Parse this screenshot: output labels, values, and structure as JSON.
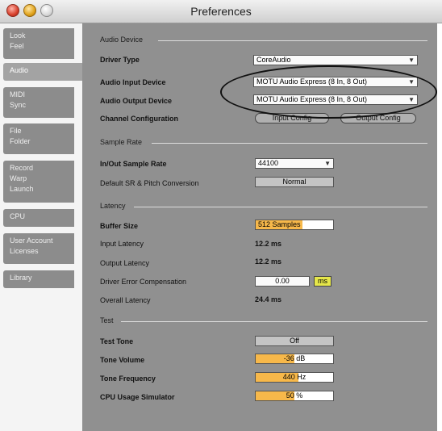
{
  "window": {
    "title": "Preferences"
  },
  "sidebar": {
    "tabs": [
      {
        "line1": "Look",
        "line2": "Feel",
        "line3": ""
      },
      {
        "line1": "Audio",
        "line2": "",
        "line3": ""
      },
      {
        "line1": "MIDI",
        "line2": "Sync",
        "line3": ""
      },
      {
        "line1": "File",
        "line2": "Folder",
        "line3": ""
      },
      {
        "line1": "Record",
        "line2": "Warp",
        "line3": "Launch"
      },
      {
        "line1": "CPU",
        "line2": "",
        "line3": ""
      },
      {
        "line1": "User Account",
        "line2": "Licenses",
        "line3": ""
      },
      {
        "line1": "Library",
        "line2": "",
        "line3": ""
      }
    ],
    "active": "Audio"
  },
  "audio_device": {
    "section": "Audio Device",
    "driver_type": {
      "label": "Driver Type",
      "value": "CoreAudio"
    },
    "input_device": {
      "label": "Audio Input Device",
      "value": "MOTU Audio Express (8 In, 8 Out)"
    },
    "output_device": {
      "label": "Audio Output Device",
      "value": "MOTU Audio Express (8 In, 8 Out)"
    },
    "channel_config": {
      "label": "Channel Configuration",
      "input_button": "Input Config",
      "output_button": "Output Config"
    }
  },
  "sample_rate": {
    "section": "Sample Rate",
    "in_out": {
      "label": "In/Out Sample Rate",
      "value": "44100"
    },
    "conversion": {
      "label": "Default SR & Pitch Conversion",
      "value": "Normal"
    }
  },
  "latency": {
    "section": "Latency",
    "buffer_size": {
      "label": "Buffer Size",
      "value": "512 Samples",
      "fill": 0.6
    },
    "input_latency": {
      "label": "Input Latency",
      "value": "12.2 ms"
    },
    "output_latency": {
      "label": "Output Latency",
      "value": "12.2 ms"
    },
    "driver_error": {
      "label": "Driver Error Compensation",
      "value": "0.00",
      "unit_button": "ms"
    },
    "overall_latency": {
      "label": "Overall Latency",
      "value": "24.4 ms"
    }
  },
  "test": {
    "section": "Test",
    "test_tone": {
      "label": "Test Tone",
      "value": "Off"
    },
    "tone_volume": {
      "label": "Tone Volume",
      "value": "-36 dB",
      "fill": 0.5
    },
    "tone_frequency": {
      "label": "Tone Frequency",
      "value": "440 Hz",
      "fill": 0.55
    },
    "cpu_usage": {
      "label": "CPU Usage Simulator",
      "value": "50 %",
      "fill": 0.5
    }
  }
}
